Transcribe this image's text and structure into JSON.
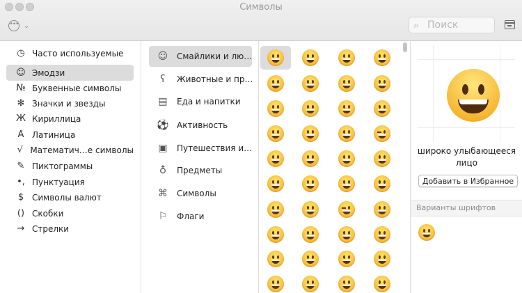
{
  "window": {
    "title": "Символы"
  },
  "toolbar": {
    "more_glyph": "•••",
    "chevron_glyph": "⌄"
  },
  "search": {
    "placeholder": "Поиск"
  },
  "sidebar": {
    "items": [
      {
        "label": "Часто используемые",
        "icon": "clock-icon",
        "glyph": "◷",
        "selected": false
      },
      {
        "label": "Эмодзи",
        "icon": "smiley-icon",
        "glyph": "☺",
        "selected": true
      },
      {
        "label": "Буквенные символы",
        "icon": "numero-icon",
        "glyph": "№",
        "selected": false
      },
      {
        "label": "Значки и звезды",
        "icon": "asterisk-icon",
        "glyph": "✻",
        "selected": false
      },
      {
        "label": "Кириллица",
        "icon": "cyrillic-zhe-icon",
        "glyph": "Ж",
        "selected": false
      },
      {
        "label": "Латиница",
        "icon": "latin-a-icon",
        "glyph": "A",
        "selected": false
      },
      {
        "label": "Математич…е символы",
        "icon": "square-root-icon",
        "glyph": "√",
        "selected": false
      },
      {
        "label": "Пиктограммы",
        "icon": "pictogram-icon",
        "glyph": "✎",
        "selected": false
      },
      {
        "label": "Пунктуация",
        "icon": "punctuation-icon",
        "glyph": "•,",
        "selected": false
      },
      {
        "label": "Символы валют",
        "icon": "dollar-icon",
        "glyph": "$",
        "selected": false
      },
      {
        "label": "Скобки",
        "icon": "parentheses-icon",
        "glyph": "()",
        "selected": false
      },
      {
        "label": "Стрелки",
        "icon": "arrow-right-icon",
        "glyph": "→",
        "selected": false
      }
    ]
  },
  "categories": {
    "items": [
      {
        "label": "Смайлики и лю…",
        "icon": "smiley-icon",
        "glyph": "☺",
        "selected": true
      },
      {
        "label": "Животные и пр…",
        "icon": "bear-icon",
        "glyph": "ʕ",
        "selected": false
      },
      {
        "label": "Еда и напитки",
        "icon": "cake-icon",
        "glyph": "▤",
        "selected": false
      },
      {
        "label": "Активность",
        "icon": "soccer-ball-icon",
        "glyph": "⚽",
        "selected": false
      },
      {
        "label": "Путешествия и…",
        "icon": "car-icon",
        "glyph": "▣",
        "selected": false
      },
      {
        "label": "Предметы",
        "icon": "lightbulb-icon",
        "glyph": "♁",
        "selected": false
      },
      {
        "label": "Символы",
        "icon": "symbols-icon",
        "glyph": "⌘",
        "selected": false
      },
      {
        "label": "Флаги",
        "icon": "flag-icon",
        "glyph": "⚐",
        "selected": false
      }
    ]
  },
  "emoji_grid": {
    "selected_index": 0,
    "cells": [
      "grinning-face",
      "grinning-face-big-eyes",
      "grinning-smiling-eyes",
      "beaming-face",
      "squinting-laughing",
      "holding-back-tears",
      "grinning-sweat",
      "tears-of-joy",
      "rolling-laughing",
      "smiling-with-tear",
      "smiling-blush",
      "smiling-eyes",
      "smiling-halo",
      "slightly-smiling",
      "upside-down",
      "winking",
      "relieved",
      "heart-eyes",
      "smiling-hearts",
      "blowing-kiss",
      "kissing",
      "kissing-smiling-eyes",
      "kissing-closed-eyes",
      "savoring-food",
      "tongue-out",
      "squinting-tongue",
      "winking-tongue",
      "zany",
      "raised-eyebrow",
      "monocle",
      "nerd",
      "sunglasses",
      "disguised",
      "star-struck",
      "partying",
      "unamused",
      "row10-a",
      "row10-b",
      "row10-c",
      "row10-d"
    ]
  },
  "detail": {
    "emoji_name": "широко улыбающееся лицо",
    "favorites_button": "Добавить в Избранное",
    "font_variants_title": "Варианты шрифтов"
  }
}
